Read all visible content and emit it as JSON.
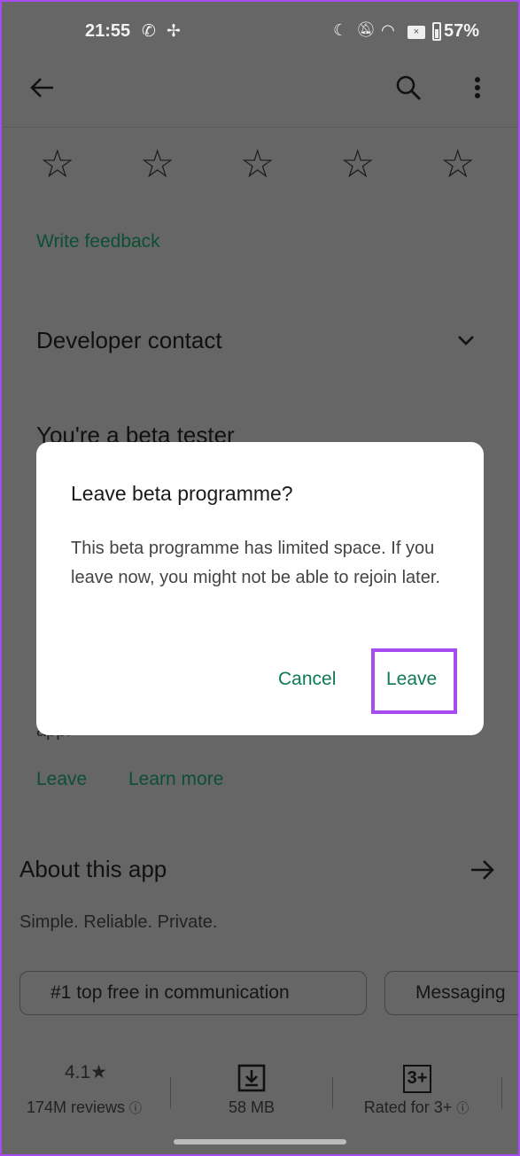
{
  "status_bar": {
    "time": "21:55",
    "battery": "57%",
    "icons": [
      "whatsapp-icon",
      "pinwheel-icon",
      "moon-icon",
      "bell-off-icon",
      "wifi-icon",
      "no-sim-icon",
      "battery-icon"
    ]
  },
  "toolbar": {
    "back": "back-arrow-icon",
    "search": "search-icon",
    "more": "more-vert-icon"
  },
  "rating": {
    "stars": 5,
    "write_feedback": "Write feedback"
  },
  "developer_contact": "Developer contact",
  "beta": {
    "title": "You're a beta tester",
    "trailing": "app.",
    "leave": "Leave",
    "learn_more": "Learn more"
  },
  "about": {
    "title": "About this app",
    "tagline": "Simple. Reliable. Private."
  },
  "chips": [
    "#1 top free in communication",
    "Messaging"
  ],
  "stats": {
    "rating": "4.1★",
    "reviews": "174M reviews",
    "size": "58 MB",
    "content_rating_badge": "3+",
    "content_rating": "Rated for 3+"
  },
  "dialog": {
    "title": "Leave beta programme?",
    "body": "This beta programme has limited space. If you leave now, you might not be able to rejoin later.",
    "cancel": "Cancel",
    "leave": "Leave"
  },
  "colors": {
    "accent": "#0e7a55",
    "highlight": "#a64cf0",
    "scrim": "#666666"
  }
}
